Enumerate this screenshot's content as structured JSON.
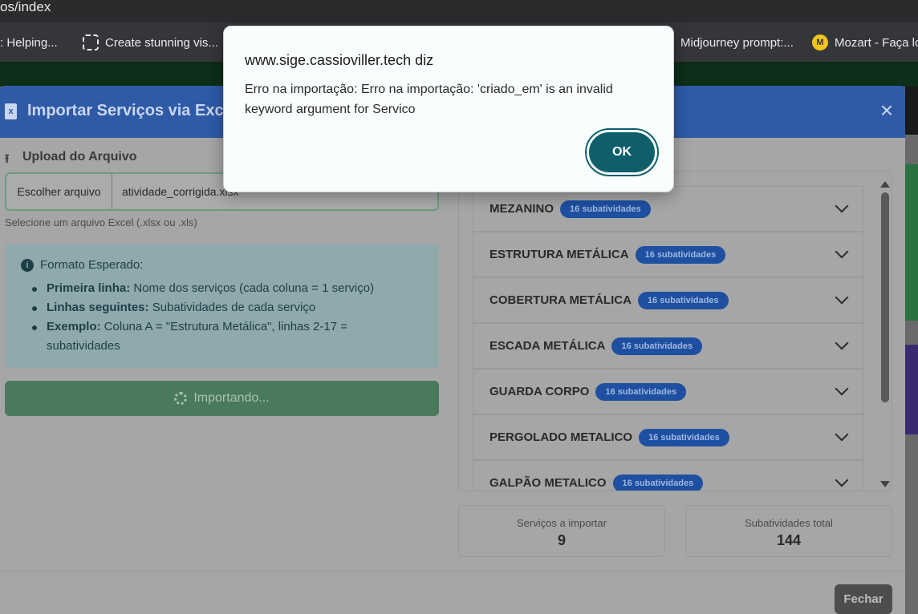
{
  "browser": {
    "url_fragment": "os/index",
    "bookmarks": [
      {
        "label": ": Helping...",
        "icon": "none"
      },
      {
        "label": "Create stunning vis...",
        "icon": "frame-icon"
      },
      {
        "label": "Midjourney prompt:...",
        "icon": "none"
      },
      {
        "label": "Mozart - Faça lo",
        "icon": "mozart-icon"
      }
    ],
    "mozart_icon_glyph": "M"
  },
  "modal": {
    "title": "Importar Serviços via Excel",
    "excel_glyph": "x",
    "close_glyph": "×",
    "upload": {
      "label": "Upload do Arquivo",
      "choose_button": "Escolher arquivo",
      "file_name": "atividade_corrigida.xlsx",
      "help": "Selecione um arquivo Excel (.xlsx ou .xls)"
    },
    "info": {
      "title": "Formato Esperado:",
      "items": [
        {
          "strong": "Primeira linha:",
          "text": " Nome dos serviços (cada coluna = 1 serviço)"
        },
        {
          "strong": "Linhas seguintes:",
          "text": " Subatividades de cada serviço"
        },
        {
          "strong": "Exemplo:",
          "text": " Coluna A = \"Estrutura Metálica\", linhas 2-17 = subatividades"
        }
      ]
    },
    "import_button": "Importando...",
    "services": [
      {
        "name": "MEZANINO",
        "badge": "16 subatividades"
      },
      {
        "name": "ESTRUTURA METÁLICA",
        "badge": "16 subatividades"
      },
      {
        "name": "COBERTURA METÁLICA",
        "badge": "16 subatividades"
      },
      {
        "name": "ESCADA METÁLICA",
        "badge": "16 subatividades"
      },
      {
        "name": "GUARDA CORPO",
        "badge": "16 subatividades"
      },
      {
        "name": "PERGOLADO METALICO",
        "badge": "16 subatividades"
      },
      {
        "name": "GALPÃO METALICO",
        "badge": "16 subatividades"
      }
    ],
    "stats": [
      {
        "label": "Serviços a importar",
        "value": "9"
      },
      {
        "label": "Subatividades total",
        "value": "144"
      }
    ],
    "close_button": "Fechar"
  },
  "alert": {
    "title": "www.sige.cassioviller.tech diz",
    "message": "Erro na importação: Erro na importação: 'criado_em' is an invalid keyword argument for Servico",
    "ok": "OK"
  },
  "colors": {
    "modal_header": "#2f5aa6",
    "badge": "#1e4fa0",
    "alert_ok": "#0e5f6b",
    "import_button": "#4a7a5c"
  }
}
